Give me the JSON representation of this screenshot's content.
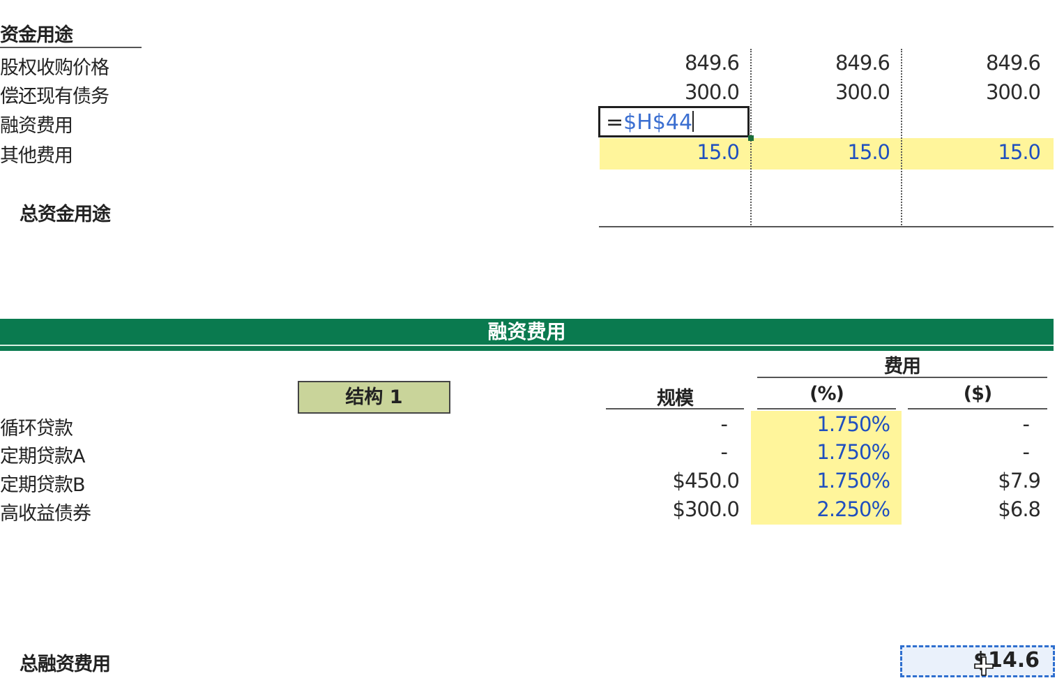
{
  "uses": {
    "title": "资金用途",
    "rows": [
      {
        "label": "股权收购价格",
        "values": [
          "849.6",
          "849.6",
          "849.6"
        ]
      },
      {
        "label": "偿还现有债务",
        "values": [
          "300.0",
          "300.0",
          "300.0"
        ]
      },
      {
        "label": "融资费用",
        "values": [
          "",
          "",
          ""
        ]
      },
      {
        "label": "其他费用",
        "values": [
          "15.0",
          "15.0",
          "15.0"
        ]
      }
    ],
    "total_label": "总资金用途",
    "editing_cell": {
      "eq": "=",
      "ref": "$H$44"
    }
  },
  "financing": {
    "banner_title": "融资费用",
    "structure_button": "结构 1",
    "header_fee": "费用",
    "header_size": "规模",
    "header_pct": "(%)",
    "header_dollar": "($)",
    "rows": [
      {
        "label": "循环贷款",
        "size": "-",
        "pct": "1.750%",
        "dollar": "-"
      },
      {
        "label": "定期贷款A",
        "size": "-",
        "pct": "1.750%",
        "dollar": "-"
      },
      {
        "label": "定期贷款B",
        "size": "$450.0",
        "pct": "1.750%",
        "dollar": "$7.9"
      },
      {
        "label": "高收益债券",
        "size": "$300.0",
        "pct": "2.250%",
        "dollar": "$6.8"
      }
    ],
    "total_label": "总融资费用",
    "total_value": "$14.6"
  },
  "colors": {
    "banner": "#0a7a4f",
    "input_highlight": "#fff59b",
    "input_text": "#1f4fbf",
    "structure_button": "#c9d49a"
  }
}
